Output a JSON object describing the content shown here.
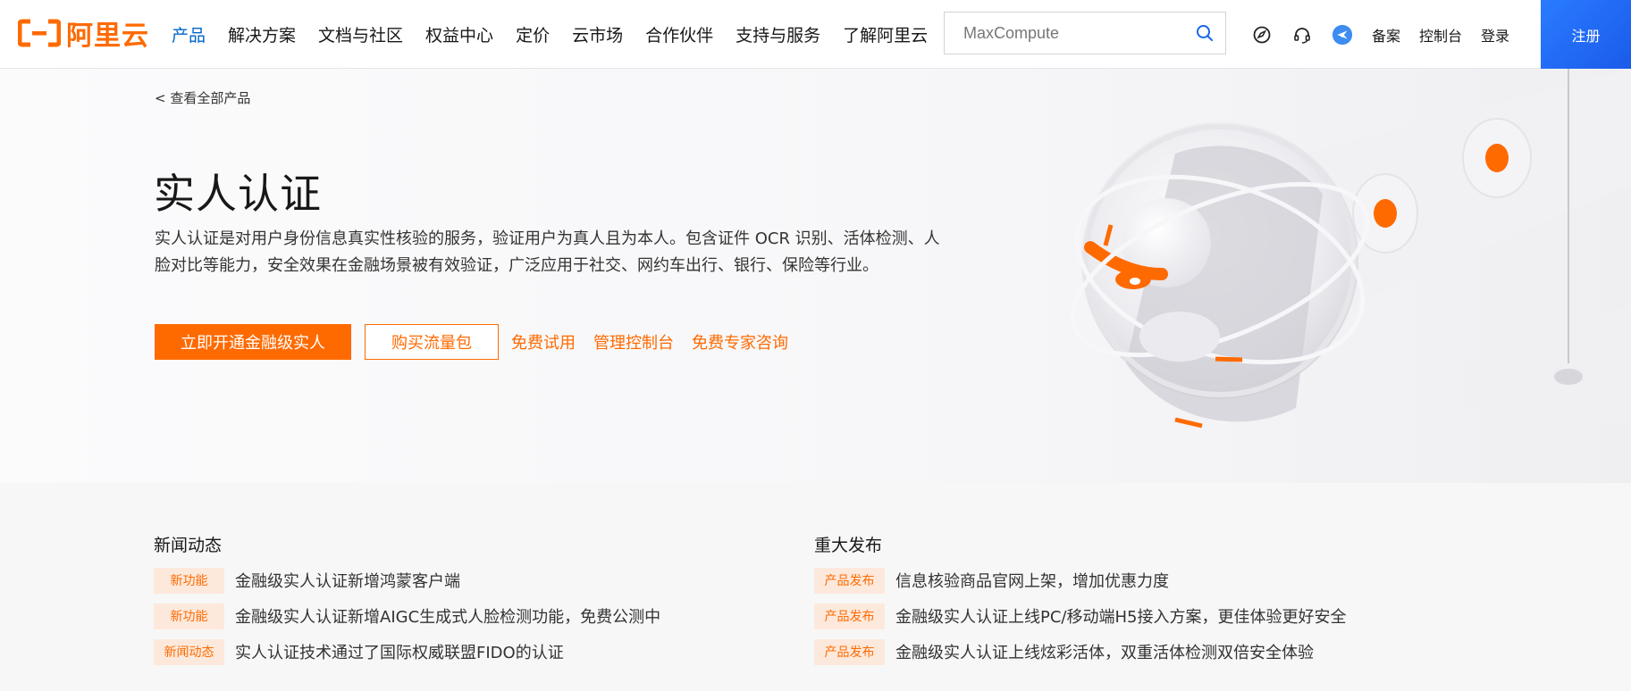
{
  "header": {
    "logo_text": "阿里云",
    "nav": [
      "产品",
      "解决方案",
      "文档与社区",
      "权益中心",
      "定价",
      "云市场",
      "合作伙伴",
      "支持与服务",
      "了解阿里云"
    ],
    "search": {
      "placeholder": "MaxCompute"
    },
    "links": [
      "备案",
      "控制台",
      "登录"
    ],
    "register": "注册",
    "icons": [
      "compass-icon",
      "headset-icon",
      "plane-icon",
      "search-icon"
    ]
  },
  "hero": {
    "back_link": "< 查看全部产品",
    "title": "实人认证",
    "description": "实人认证是对用户身份信息真实性核验的服务，验证用户为真人且为本人。包含证件 OCR 识别、活体检测、人脸对比等能力，安全效果在金融场景被有效验证，广泛应用于社交、网约车出行、银行、保险等行业。",
    "buttons": {
      "primary": "立即开通金融级实人",
      "outline": "购买流量包",
      "text_links": [
        "免费试用",
        "管理控制台",
        "免费专家咨询"
      ]
    }
  },
  "news": {
    "left": {
      "title": "新闻动态",
      "items": [
        {
          "badge": "新功能",
          "text": "金融级实人认证新增鸿蒙客户端"
        },
        {
          "badge": "新功能",
          "text": "金融级实人认证新增AIGC生成式人脸检测功能，免费公测中"
        },
        {
          "badge": "新闻动态",
          "text": "实人认证技术通过了国际权威联盟FIDO的认证"
        }
      ]
    },
    "right": {
      "title": "重大发布",
      "items": [
        {
          "badge": "产品发布",
          "text": "信息核验商品官网上架，增加优惠力度"
        },
        {
          "badge": "产品发布",
          "text": "金融级实人认证上线PC/移动端H5接入方案，更佳体验更好安全"
        },
        {
          "badge": "产品发布",
          "text": "金融级实人认证上线炫彩活体，双重活体检测双倍安全体验"
        }
      ]
    }
  },
  "colors": {
    "brand": "#ff6a00",
    "link_active": "#0064c8",
    "badge_bg": "#fde9dc"
  }
}
